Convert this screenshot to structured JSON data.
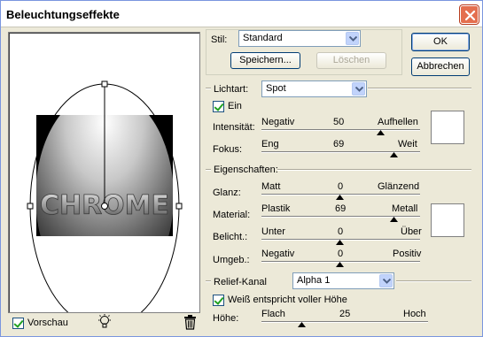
{
  "window": {
    "title": "Beleuchtungseffekte"
  },
  "preview": {
    "relief_text": "CHROME",
    "vorschau_label": "Vorschau",
    "vorschau_checked": true
  },
  "style": {
    "label": "Stil:",
    "value": "Standard",
    "save_label": "Speichern...",
    "delete_label": "Löschen"
  },
  "buttons": {
    "ok": "OK",
    "cancel": "Abbrechen"
  },
  "light": {
    "type_label": "Lichtart:",
    "type_value": "Spot",
    "on_label": "Ein",
    "on_checked": true,
    "intensity": {
      "label": "Intensität:",
      "min": "Negativ",
      "max": "Aufhellen",
      "value": "50"
    },
    "focus": {
      "label": "Fokus:",
      "min": "Eng",
      "max": "Weit",
      "value": "69"
    },
    "color": "#ffffff"
  },
  "properties": {
    "header": "Eigenschaften:",
    "gloss": {
      "label": "Glanz:",
      "min": "Matt",
      "max": "Glänzend",
      "value": "0"
    },
    "material": {
      "label": "Material:",
      "min": "Plastik",
      "max": "Metall",
      "value": "69"
    },
    "exposure": {
      "label": "Belicht.:",
      "min": "Unter",
      "max": "Über",
      "value": "0"
    },
    "ambience": {
      "label": "Umgeb.:",
      "min": "Negativ",
      "max": "Positiv",
      "value": "0"
    },
    "color": "#ffffff"
  },
  "relief": {
    "channel_label": "Relief-Kanal",
    "channel_value": "Alpha 1",
    "white_high_label": "Weiß entspricht voller Höhe",
    "white_high_checked": true,
    "height": {
      "label": "Höhe:",
      "min": "Flach",
      "max": "Hoch",
      "value": "25"
    }
  },
  "icons": {
    "close": "close-icon",
    "lightbulb": "lightbulb-icon",
    "trash": "trash-icon",
    "dropdown": "chevron-down-icon"
  }
}
